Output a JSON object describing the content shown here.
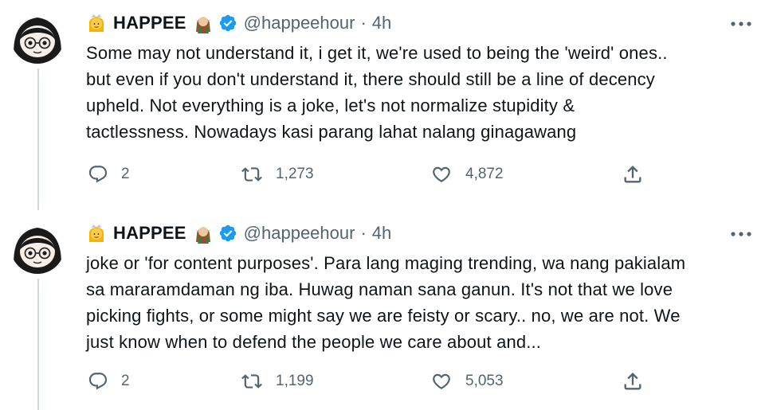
{
  "tweets": [
    {
      "name": "HAPPEE",
      "handle": "@happeehour",
      "separator": "·",
      "time": "4h",
      "text": "Some may not understand it, i get it, we're used to being the 'weird' ones..\nbut even if you don't understand it, there should still be a line of decency\nupheld. Not everything is a joke, let's not normalize stupidity &\ntactlessness. Nowadays kasi parang lahat nalang ginagawang",
      "replies": "2",
      "retweets": "1,273",
      "likes": "4,872"
    },
    {
      "name": "HAPPEE",
      "handle": "@happeehour",
      "separator": "·",
      "time": "4h",
      "text": "joke or 'for content purposes'. Para lang maging trending, wa nang pakialam\nsa mararamdaman ng iba. Huwag naman sana ganun. It's not that we love\npicking fights, or some might say we are feisty or scary.. no, we are not. We\njust know when to defend the people we care about and...",
      "replies": "2",
      "retweets": "1,199",
      "likes": "5,053"
    }
  ],
  "icons": {
    "name_prefix": "princess-emoji-icon",
    "name_suffix": "woman-elf-emoji-icon",
    "verified": "verified-badge-icon",
    "more": "more-options-icon",
    "reply": "reply-icon",
    "retweet": "retweet-icon",
    "like": "like-icon",
    "share": "share-icon"
  },
  "colors": {
    "text": "#0f1419",
    "secondary": "#536471",
    "verified": "#1d9bf0",
    "thread_line": "#cfd9de"
  }
}
